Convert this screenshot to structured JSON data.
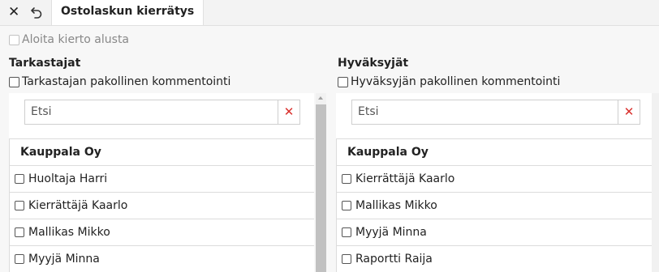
{
  "toolbar": {
    "tab_title": "Ostolaskun kierrätys"
  },
  "restart": {
    "label": "Aloita kierto alusta",
    "checked": false,
    "disabled": true
  },
  "reviewers": {
    "title": "Tarkastajat",
    "required_comment_label": "Tarkastajan pakollinen kommentointi",
    "search_placeholder": "Etsi",
    "group": "Kauppala Oy",
    "items": [
      "Huoltaja Harri",
      "Kierrättäjä Kaarlo",
      "Mallikas Mikko",
      "Myyjä Minna"
    ]
  },
  "approvers": {
    "title": "Hyväksyjät",
    "required_comment_label": "Hyväksyjän pakollinen kommentointi",
    "search_placeholder": "Etsi",
    "group": "Kauppala Oy",
    "items": [
      "Kierrättäjä Kaarlo",
      "Mallikas Mikko",
      "Myyjä Minna",
      "Raportti Raija"
    ]
  },
  "icons": {
    "close": "close-icon",
    "undo": "undo-icon",
    "clear": "clear-icon"
  },
  "colors": {
    "clear": "#d9302c"
  }
}
